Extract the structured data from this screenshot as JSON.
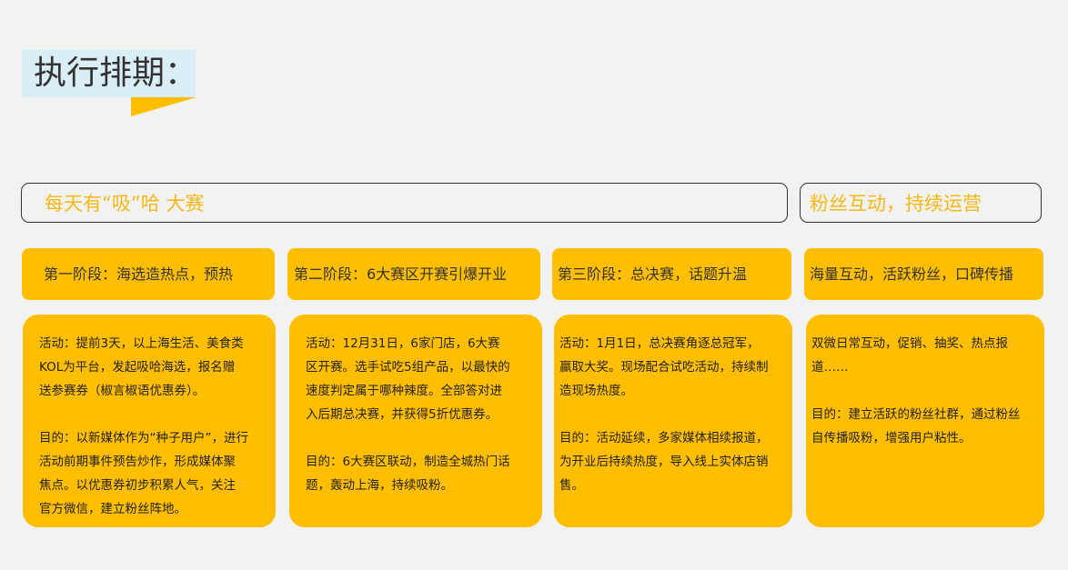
{
  "page_title": "执行排期：",
  "colors": {
    "accent": "#ffbf00",
    "highlight_text": "#f6b817",
    "title_background": "#d9eef5"
  },
  "campaign_bars": [
    {
      "label": "每天有“吸”哈   大赛"
    },
    {
      "label": "粉丝互动，持续运营"
    }
  ],
  "stages": [
    {
      "label": "第一阶段：海选造热点，预热",
      "activity": "活动：提前3天，以上海生活、美食类\nKOL为平台，发起吸哈海选，报名赠\n送参赛券（椒言椒语优惠券）。",
      "goal": "目的：以新媒体作为“种子用户”，进行\n活动前期事件预告炒作，形成媒体聚\n焦点。以优惠券初步积累人气，关注\n官方微信，建立粉丝阵地。"
    },
    {
      "label": "第二阶段：6大赛区开赛引爆开业",
      "activity": "活动：12月31日，6家门店，6大赛\n区开赛。选手试吃5组产品，以最快的\n速度判定属于哪种辣度。全部答对进\n入后期总决赛，并获得5折优惠券。",
      "goal": "目的：6大赛区联动，制造全城热门话\n题，轰动上海，持续吸粉。"
    },
    {
      "label": "第三阶段：总决赛，话题升温",
      "activity": "活动：1月1日，总决赛角逐总冠军，\n赢取大奖。现场配合试吃活动，持续制\n造现场热度。",
      "goal": "目的：活动延续，多家媒体相续报道，\n为开业后持续热度，导入线上实体店销\n售。"
    },
    {
      "label": "海量互动，活跃粉丝，口碑传播",
      "activity": "双微日常互动，促销、抽奖、热点报\n道……",
      "goal": "目的：建立活跃的粉丝社群，通过粉丝\n自传播吸粉，增强用户粘性。"
    }
  ]
}
